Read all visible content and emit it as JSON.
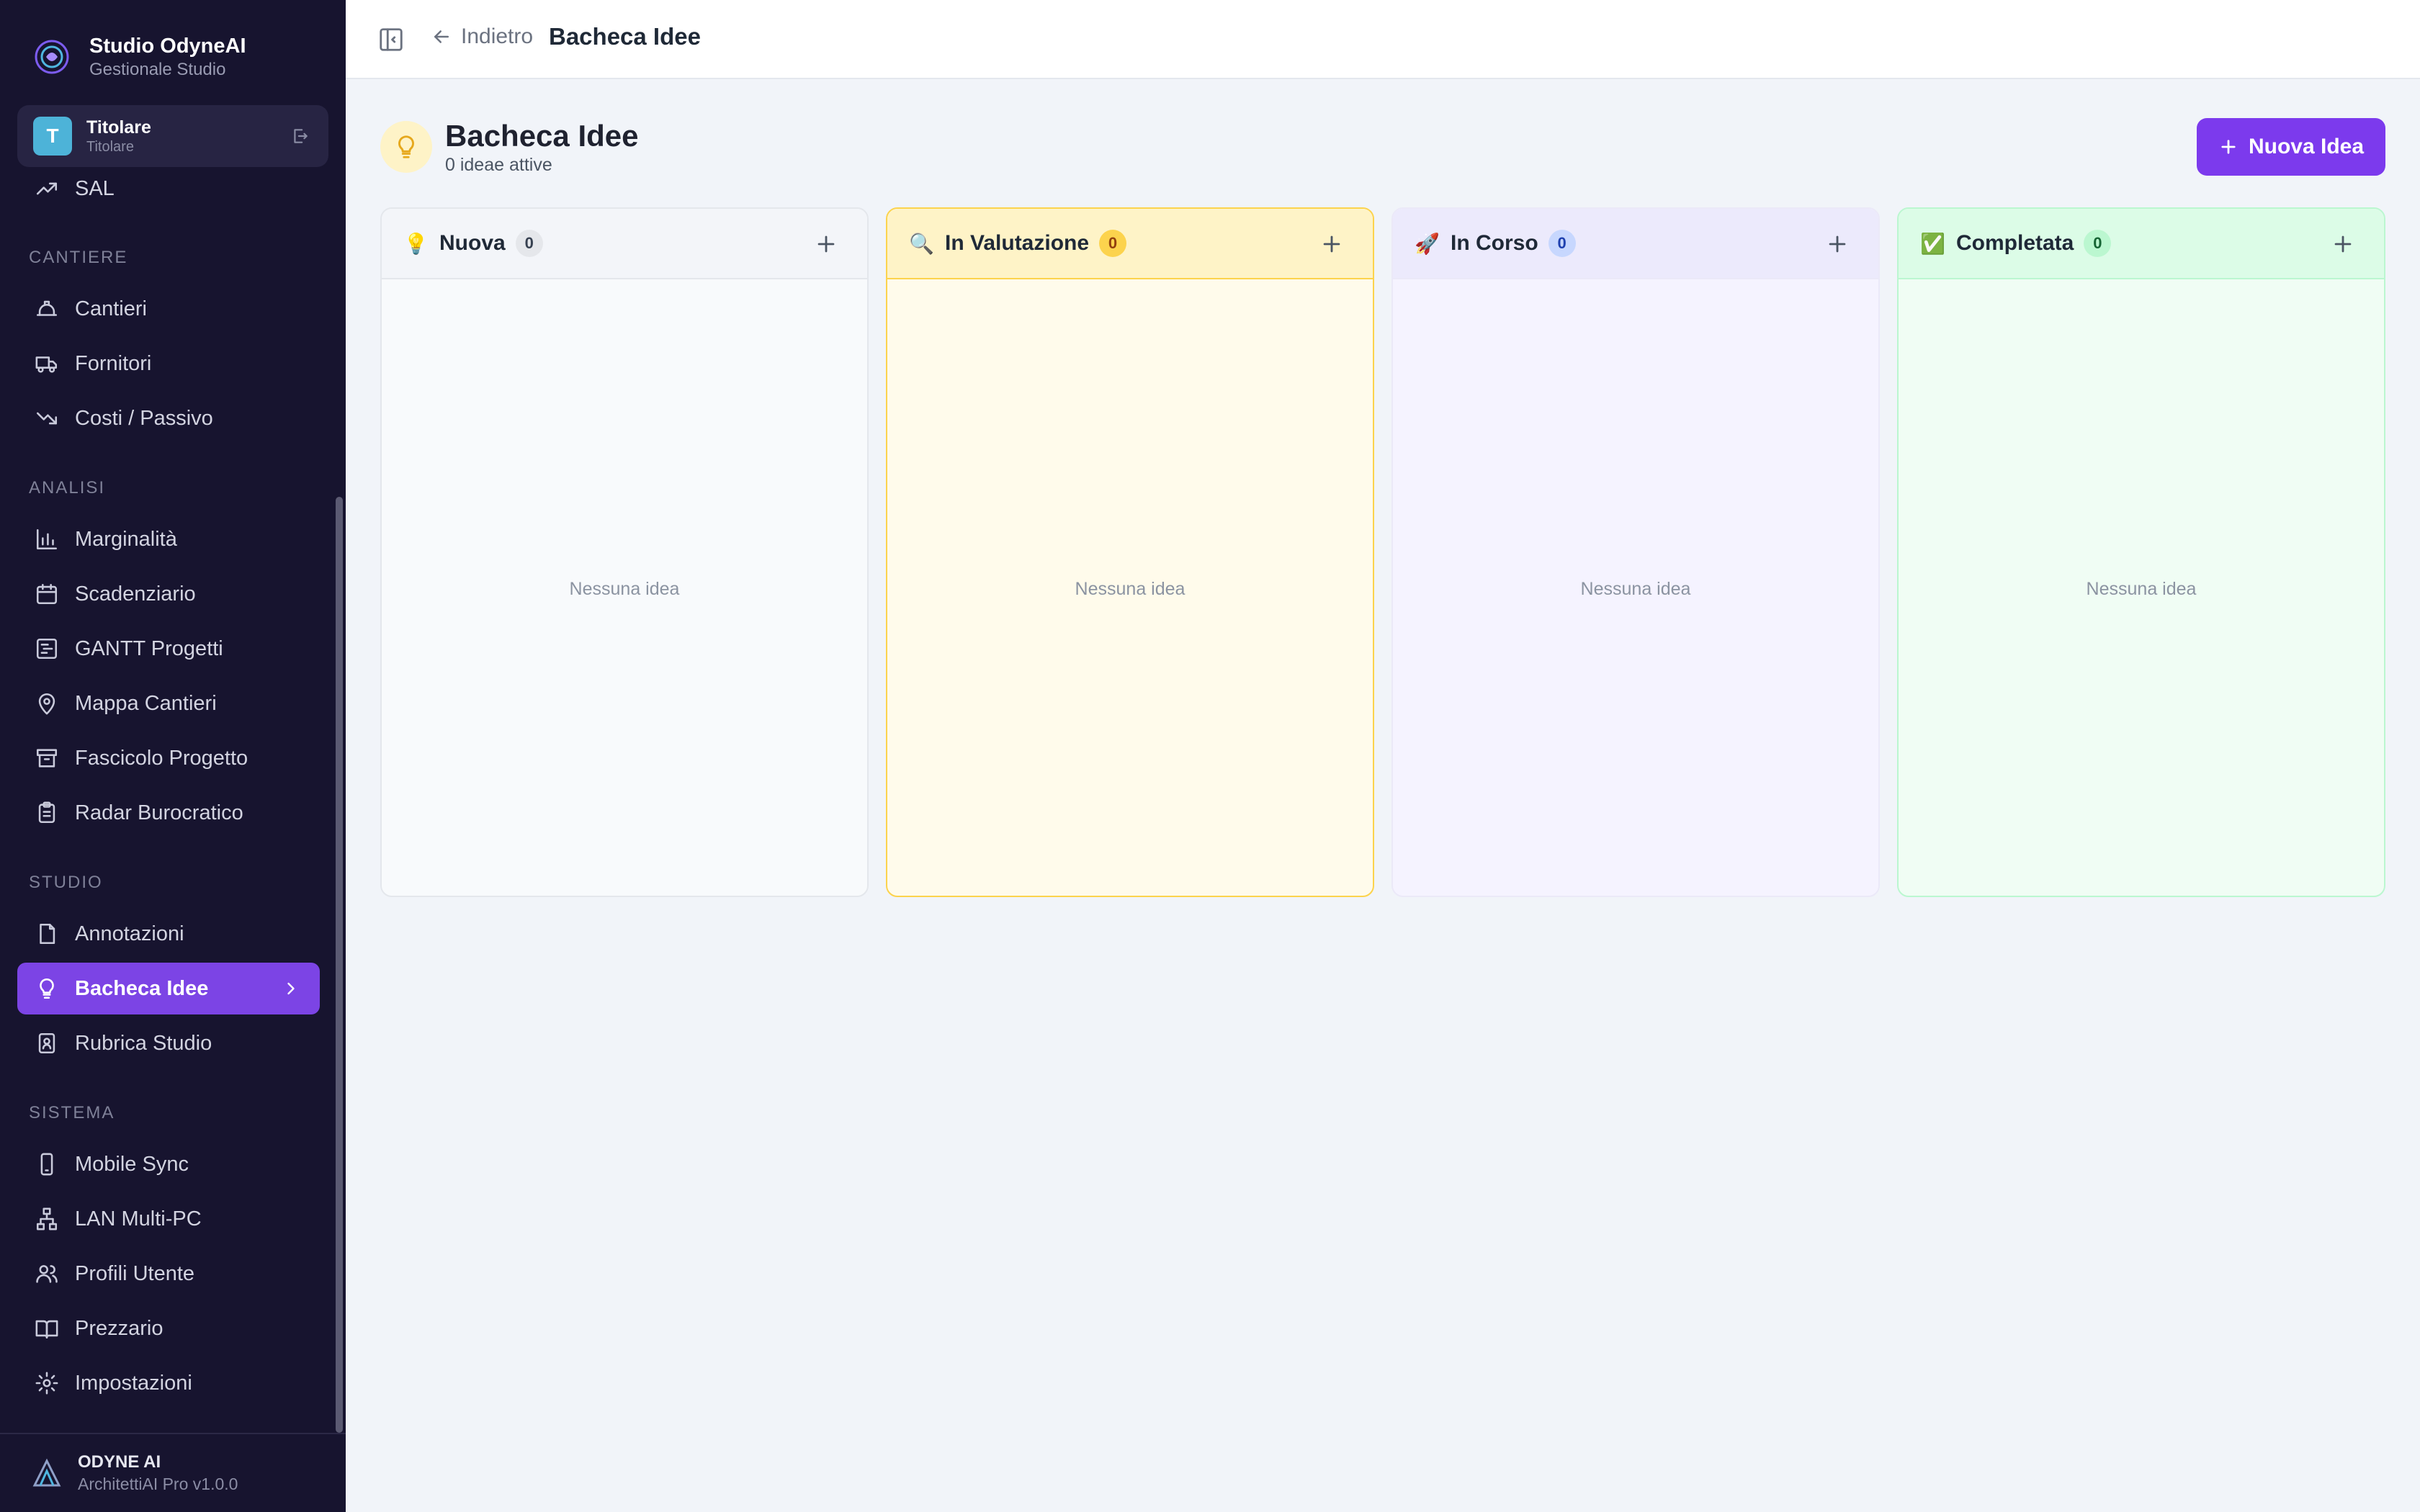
{
  "brand": {
    "title": "Studio OdyneAI",
    "subtitle": "Gestionale Studio"
  },
  "user": {
    "initial": "T",
    "name": "Titolare",
    "role": "Titolare"
  },
  "nav": {
    "top_items": [
      {
        "label": "SAL",
        "icon": "trending-up-icon"
      }
    ],
    "sections": [
      {
        "title": "CANTIERE",
        "items": [
          {
            "label": "Cantieri",
            "icon": "helmet-icon"
          },
          {
            "label": "Fornitori",
            "icon": "truck-icon"
          },
          {
            "label": "Costi / Passivo",
            "icon": "trending-down-icon"
          }
        ]
      },
      {
        "title": "ANALISI",
        "items": [
          {
            "label": "Marginalità",
            "icon": "bar-chart-icon"
          },
          {
            "label": "Scadenziario",
            "icon": "calendar-icon"
          },
          {
            "label": "GANTT Progetti",
            "icon": "gantt-icon"
          },
          {
            "label": "Mappa Cantieri",
            "icon": "map-pin-icon"
          },
          {
            "label": "Fascicolo Progetto",
            "icon": "archive-icon"
          },
          {
            "label": "Radar Burocratico",
            "icon": "clipboard-icon"
          }
        ]
      },
      {
        "title": "STUDIO",
        "items": [
          {
            "label": "Annotazioni",
            "icon": "file-icon"
          },
          {
            "label": "Bacheca Idee",
            "icon": "lightbulb-icon",
            "active": true
          },
          {
            "label": "Rubrica Studio",
            "icon": "contact-book-icon"
          }
        ]
      },
      {
        "title": "SISTEMA",
        "items": [
          {
            "label": "Mobile Sync",
            "icon": "smartphone-icon"
          },
          {
            "label": "LAN Multi-PC",
            "icon": "network-icon"
          },
          {
            "label": "Profili Utente",
            "icon": "users-icon"
          },
          {
            "label": "Prezzario",
            "icon": "book-icon"
          },
          {
            "label": "Impostazioni",
            "icon": "gear-icon"
          }
        ]
      }
    ]
  },
  "footer": {
    "title": "ODYNE AI",
    "subtitle": "ArchitettiAI Pro v1.0.0"
  },
  "topbar": {
    "back_label": "Indietro",
    "title": "Bacheca Idee"
  },
  "page": {
    "title": "Bacheca Idee",
    "subtitle": "0 ideae attive",
    "new_button": "Nuova Idea"
  },
  "columns": [
    {
      "emoji": "💡",
      "title": "Nuova",
      "count": "0",
      "empty": "Nessuna idea",
      "bg": "#f8fafc",
      "head_bg": "#f3f5f9",
      "border": "#e4e7ec",
      "badge_bg": "#e5e7eb",
      "badge_fg": "#374151"
    },
    {
      "emoji": "🔍",
      "title": "In Valutazione",
      "count": "0",
      "empty": "Nessuna idea",
      "bg": "#fffbeb",
      "head_bg": "#fef3c7",
      "border": "#fcd34d",
      "badge_bg": "#fcd34d",
      "badge_fg": "#92400e"
    },
    {
      "emoji": "🚀",
      "title": "In Corso",
      "count": "0",
      "empty": "Nessuna idea",
      "bg": "#f5f3ff",
      "head_bg": "#eceafc",
      "border": "#ebe9f8",
      "badge_bg": "#c7d7fe",
      "badge_fg": "#1e40af"
    },
    {
      "emoji": "✅",
      "title": "Completata",
      "count": "0",
      "empty": "Nessuna idea",
      "bg": "#f0fdf4",
      "head_bg": "#dcfce7",
      "border": "#bbf7d0",
      "badge_bg": "#bbf7d0",
      "badge_fg": "#166534"
    }
  ]
}
